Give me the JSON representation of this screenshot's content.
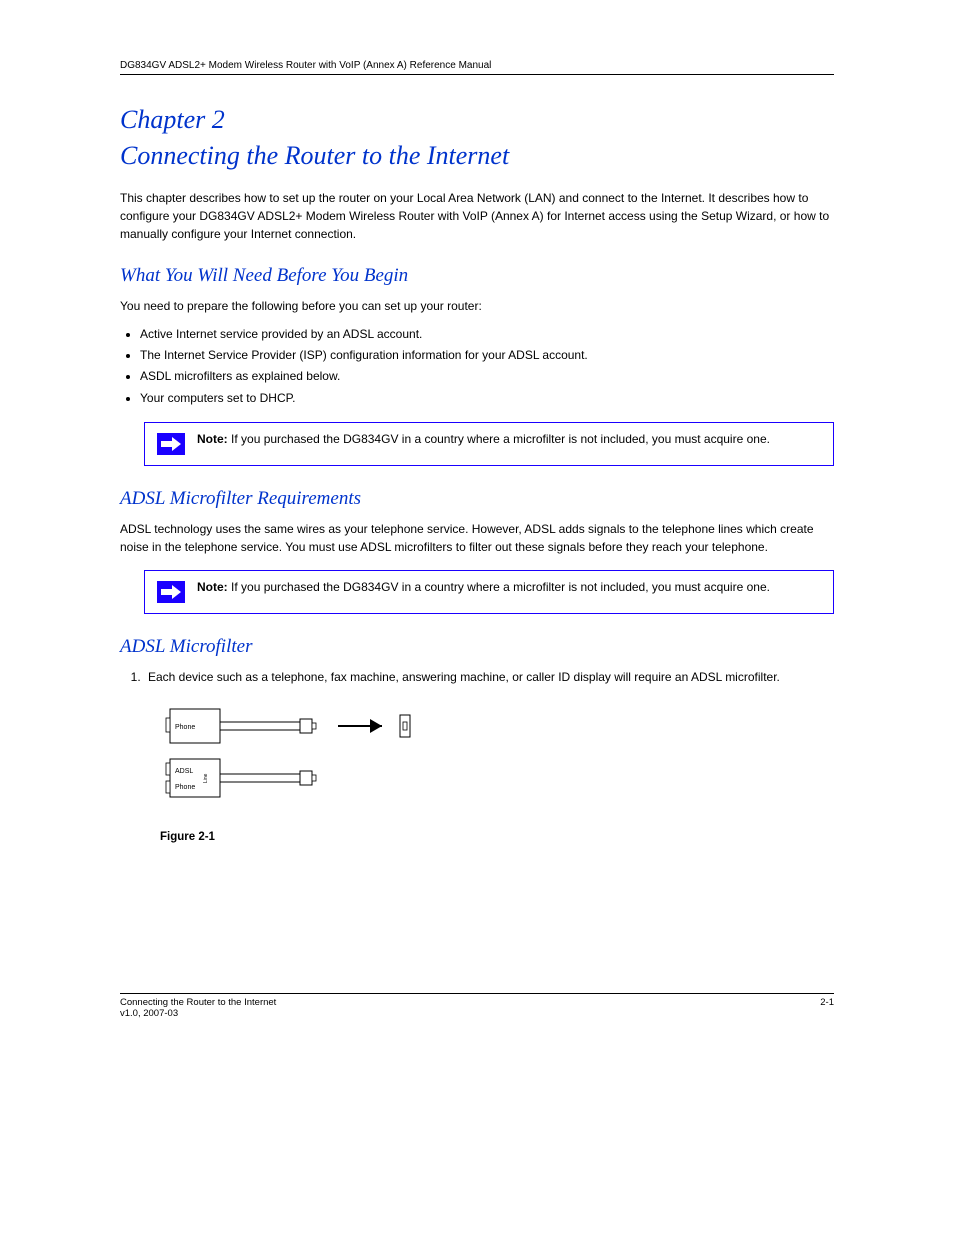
{
  "header": {
    "manual": "DG834GV ADSL2+ Modem Wireless Router with VoIP (Annex A) Reference Manual"
  },
  "chapter": {
    "label": "Chapter 2",
    "title": "Connecting the Router to the Internet"
  },
  "intro": "This chapter describes how to set up the router on your Local Area Network (LAN) and connect to the Internet. It describes how to configure your DG834GV ADSL2+ Modem Wireless Router with VoIP (Annex A) for Internet access using the Setup Wizard, or how to manually configure your Internet connection.",
  "section1": {
    "title": "What You Will Need Before You Begin",
    "text": "You need to prepare the following before you can set up your router:",
    "items": [
      "Active Internet service provided by an ADSL account.",
      "The Internet Service Provider (ISP) configuration information for your ADSL account.",
      "ASDL microfilters as explained below.",
      "Your computers set to DHCP."
    ]
  },
  "note1": {
    "label": "Note:",
    "text": "If you purchased the DG834GV in a country where a microfilter is not included, you must acquire one."
  },
  "note2": {
    "label": "Note:",
    "text": "If you purchased the DG834GV in a country where a microfilter is not included, you must acquire one."
  },
  "section2": {
    "title": "ADSL Microfilter Requirements",
    "text": "ADSL technology uses the same wires as your telephone service. However, ADSL adds signals to the telephone lines which create noise in the telephone service. You must use ADSL microfilters to filter out these signals before they reach your telephone."
  },
  "section3": {
    "title": "ADSL Microfilter",
    "step": "Each device such as a telephone, fax machine, answering machine, or caller ID display will require an ADSL microfilter.",
    "fig_caption": "Figure 2-1"
  },
  "svg_labels": {
    "phone": "Phone",
    "adsl": "ADSL",
    "line": "Line"
  },
  "footer": {
    "left": "Connecting the Router to the Internet",
    "right": "2-1",
    "version": "v1.0, 2007-03"
  }
}
